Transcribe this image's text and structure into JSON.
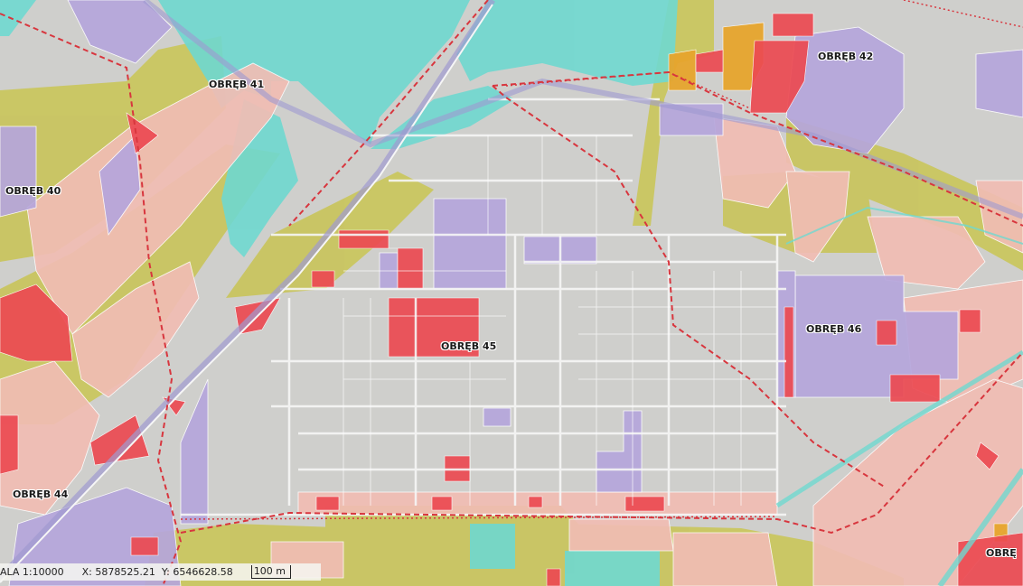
{
  "map": {
    "labels": [
      {
        "id": "obreb-41",
        "text": "OBRĘB 41"
      },
      {
        "id": "obreb-42",
        "text": "OBRĘB 42"
      },
      {
        "id": "obreb-40",
        "text": "OBRĘB 40"
      },
      {
        "id": "obreb-45",
        "text": "OBRĘB 45"
      },
      {
        "id": "obreb-46",
        "text": "OBRĘB 46"
      },
      {
        "id": "obreb-44",
        "text": "OBRĘB 44"
      },
      {
        "id": "obreb-edge",
        "text": "OBRĘ"
      }
    ],
    "colors": {
      "base": "#cfcfcc",
      "residential": "#f1bdb4",
      "green": "#c9c55a",
      "industrial": "#b6a6dc",
      "commercial": "#ec4a52",
      "water": "#6fd8d0",
      "orange": "#e7a52d",
      "roads": "#f6f6f6",
      "boundary": "#d8363e"
    }
  },
  "status": {
    "scale": "ALA 1:10000",
    "x": "X: 5878525.21",
    "y": "Y: 6546628.58",
    "scalebar": "100 m"
  }
}
